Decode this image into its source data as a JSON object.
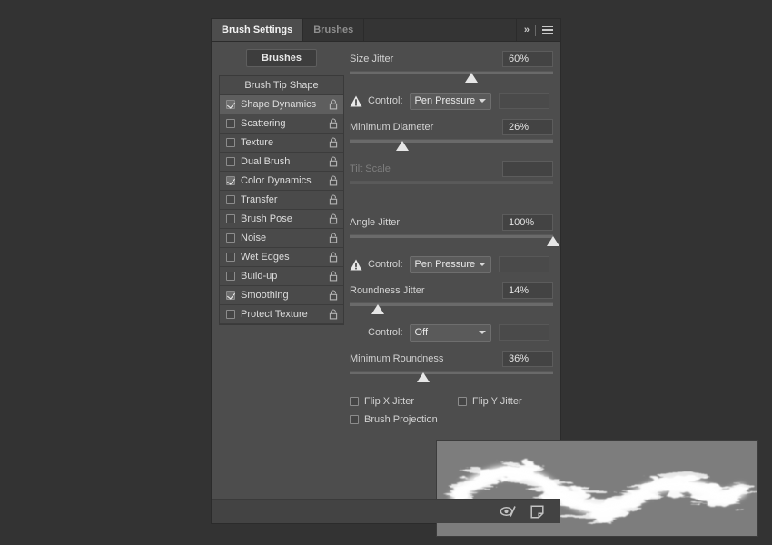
{
  "tabs": [
    {
      "label": "Brush Settings",
      "active": true
    },
    {
      "label": "Brushes",
      "active": false
    }
  ],
  "header": {
    "expand_icon": "»",
    "menu_icon": "hamburger-menu-icon"
  },
  "sidebar": {
    "brushes_button": "Brushes",
    "list_header": "Brush Tip Shape",
    "items": [
      {
        "label": "Shape Dynamics",
        "checked": true,
        "selected": true,
        "locked": false
      },
      {
        "label": "Scattering",
        "checked": false,
        "selected": false,
        "locked": false
      },
      {
        "label": "Texture",
        "checked": false,
        "selected": false,
        "locked": false
      },
      {
        "label": "Dual Brush",
        "checked": false,
        "selected": false,
        "locked": false
      },
      {
        "label": "Color Dynamics",
        "checked": true,
        "selected": false,
        "locked": false
      },
      {
        "label": "Transfer",
        "checked": false,
        "selected": false,
        "locked": false
      },
      {
        "label": "Brush Pose",
        "checked": false,
        "selected": false,
        "locked": false
      },
      {
        "label": "Noise",
        "checked": false,
        "selected": false,
        "locked": false
      },
      {
        "label": "Wet Edges",
        "checked": false,
        "selected": false,
        "locked": false
      },
      {
        "label": "Build-up",
        "checked": false,
        "selected": false,
        "locked": false
      },
      {
        "label": "Smoothing",
        "checked": true,
        "selected": false,
        "locked": false
      },
      {
        "label": "Protect Texture",
        "checked": false,
        "selected": false,
        "locked": false
      }
    ]
  },
  "settings": {
    "size_jitter": {
      "label": "Size Jitter",
      "value": "60%",
      "slider_percent": 60,
      "disabled": false
    },
    "size_control": {
      "label": "Control:",
      "value": "Pen Pressure",
      "warning": true
    },
    "minimum_diameter": {
      "label": "Minimum Diameter",
      "value": "26%",
      "slider_percent": 26,
      "disabled": false
    },
    "tilt_scale": {
      "label": "Tilt Scale",
      "value": "",
      "slider_percent": 0,
      "disabled": true
    },
    "angle_jitter": {
      "label": "Angle Jitter",
      "value": "100%",
      "slider_percent": 100,
      "disabled": false
    },
    "angle_control": {
      "label": "Control:",
      "value": "Pen Pressure",
      "warning": true
    },
    "roundness_jitter": {
      "label": "Roundness Jitter",
      "value": "14%",
      "slider_percent": 14,
      "disabled": false
    },
    "roundness_control": {
      "label": "Control:",
      "value": "Off",
      "warning": false
    },
    "minimum_roundness": {
      "label": "Minimum Roundness",
      "value": "36%",
      "slider_percent": 36,
      "disabled": false
    },
    "flip_x_jitter": {
      "label": "Flip X Jitter",
      "checked": false
    },
    "flip_y_jitter": {
      "label": "Flip Y Jitter",
      "checked": false
    },
    "brush_projection": {
      "label": "Brush Projection",
      "checked": false
    }
  },
  "footer": {
    "toggle_icon": "brush-settings-toggle-icon",
    "new_brush_icon": "new-brush-preset-icon"
  },
  "colors": {
    "app_background": "#333333",
    "panel_background": "#4d4d4d",
    "tab_inactive": "#343434",
    "row_selected": "#5e5e5e",
    "preview_background": "#7d7d7d",
    "text": "#d2d2d2",
    "text_disabled": "#7e7e7e"
  }
}
